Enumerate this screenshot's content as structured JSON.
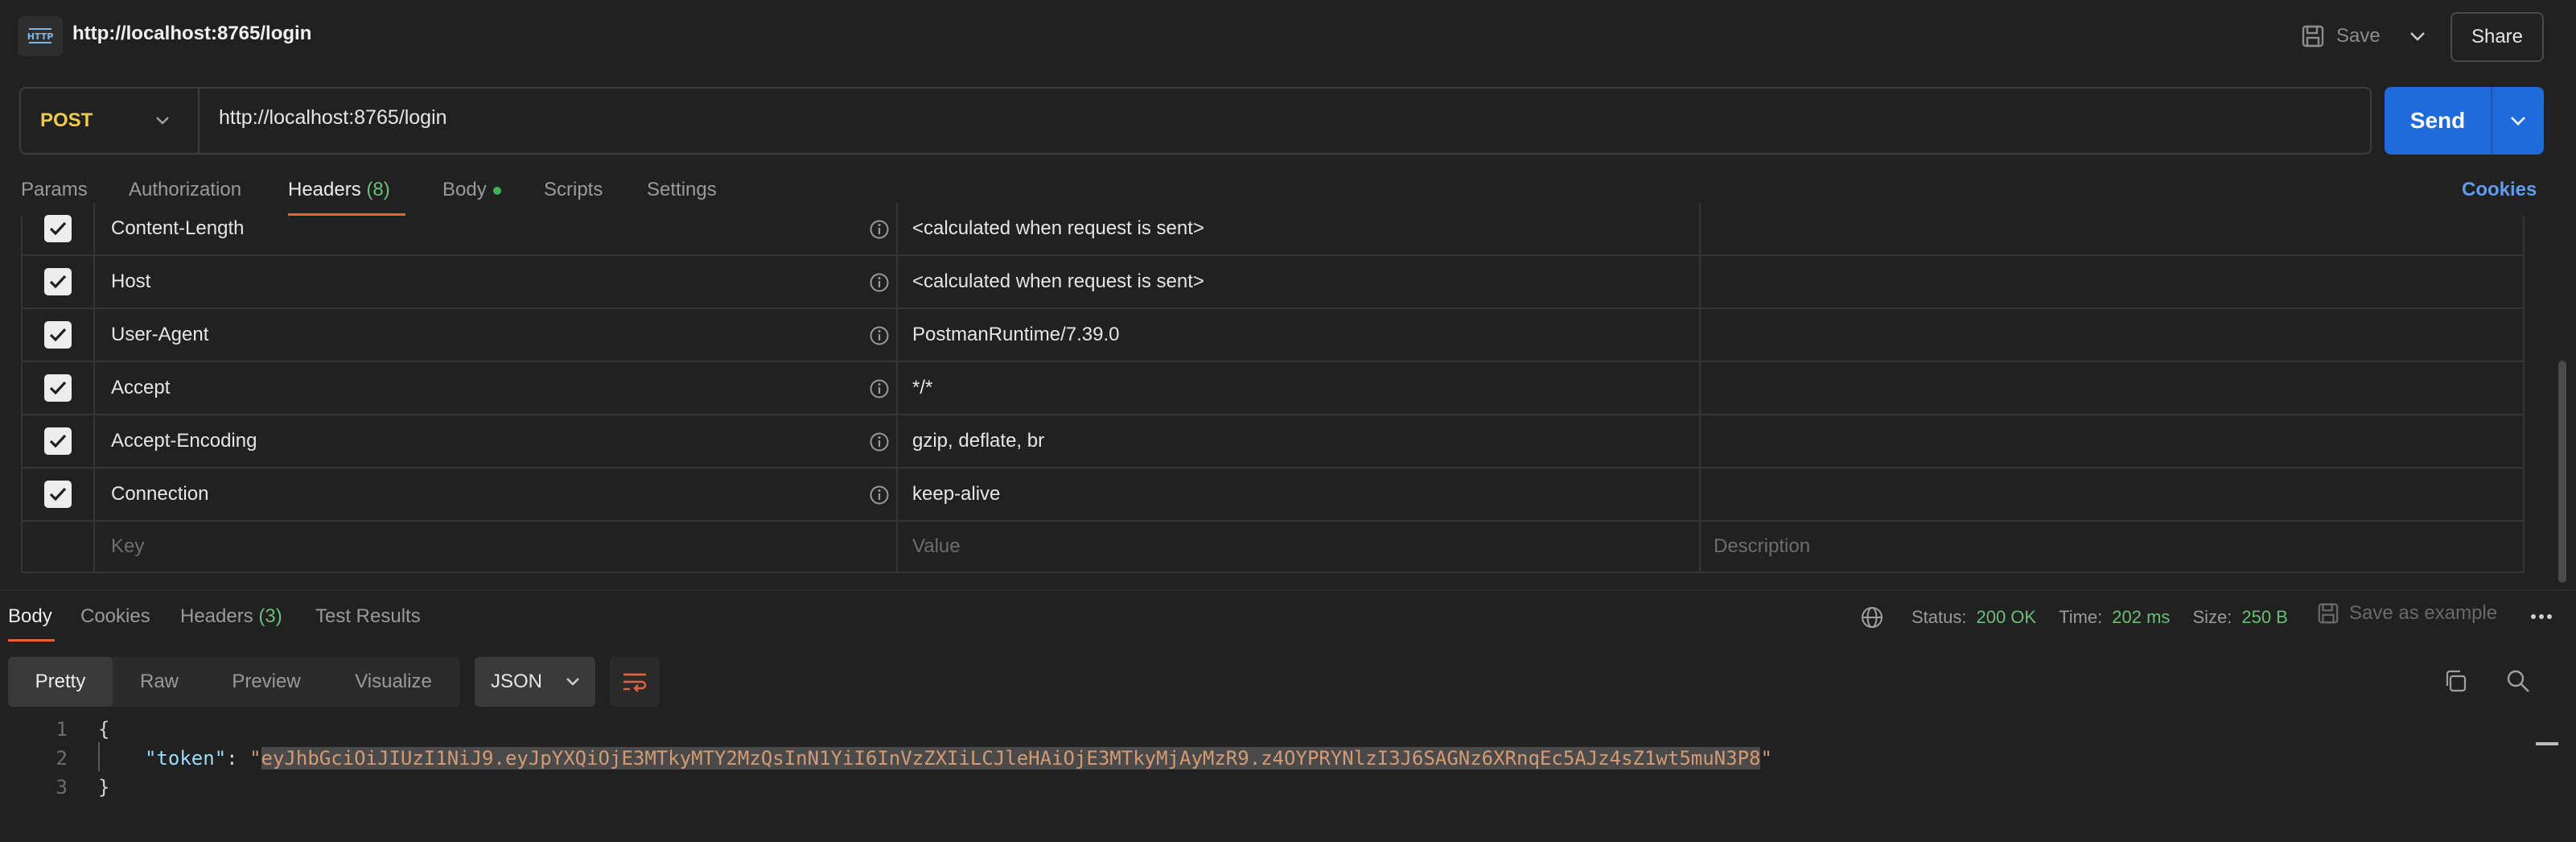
{
  "header": {
    "icon_label": "HTTP",
    "title": "http://localhost:8765/login",
    "save_label": "Save",
    "share_label": "Share"
  },
  "request": {
    "method": "POST",
    "url": "http://localhost:8765/login",
    "send_label": "Send"
  },
  "request_tabs": {
    "params": "Params",
    "authorization": "Authorization",
    "headers": "Headers",
    "headers_count": "(8)",
    "body": "Body",
    "scripts": "Scripts",
    "settings": "Settings",
    "cookies": "Cookies"
  },
  "headers_table": {
    "rows": [
      {
        "key": "Content-Length",
        "value": "<calculated when request is sent>",
        "checked": true
      },
      {
        "key": "Host",
        "value": "<calculated when request is sent>",
        "checked": true
      },
      {
        "key": "User-Agent",
        "value": "PostmanRuntime/7.39.0",
        "checked": true
      },
      {
        "key": "Accept",
        "value": "*/*",
        "checked": true
      },
      {
        "key": "Accept-Encoding",
        "value": "gzip, deflate, br",
        "checked": true
      },
      {
        "key": "Connection",
        "value": "keep-alive",
        "checked": true
      }
    ],
    "placeholder": {
      "key": "Key",
      "value": "Value",
      "description": "Description"
    }
  },
  "response_tabs": {
    "body": "Body",
    "cookies": "Cookies",
    "headers": "Headers",
    "headers_count": "(3)",
    "test_results": "Test Results"
  },
  "response_stats": {
    "status_label": "Status:",
    "status_value": "200 OK",
    "time_label": "Time:",
    "time_value": "202 ms",
    "size_label": "Size:",
    "size_value": "250 B",
    "save_example": "Save as example"
  },
  "response_view": {
    "modes": [
      "Pretty",
      "Raw",
      "Preview",
      "Visualize"
    ],
    "active_mode": "Pretty",
    "format": "JSON"
  },
  "response_body": {
    "line_numbers": [
      "1",
      "2",
      "3"
    ],
    "open_brace": "{",
    "close_brace": "}",
    "key": "\"token\"",
    "colon": ": ",
    "quote": "\"",
    "token": "eyJhbGciOiJIUzI1NiJ9.eyJpYXQiOjE3MTkyMTY2MzQsInN1YiI6InVzZXIiLCJleHAiOjE3MTkyMjAyMzR9.z4OYPRYNlzI3J6SAGNz6XRnqEc5AJz4sZ1wt5muN3P8"
  },
  "colors": {
    "accent_orange": "#e8633c",
    "send_blue": "#1f6bdc",
    "method_yellow": "#f2c94c",
    "status_green": "#6bbf73",
    "link_blue": "#5f9cf0"
  }
}
